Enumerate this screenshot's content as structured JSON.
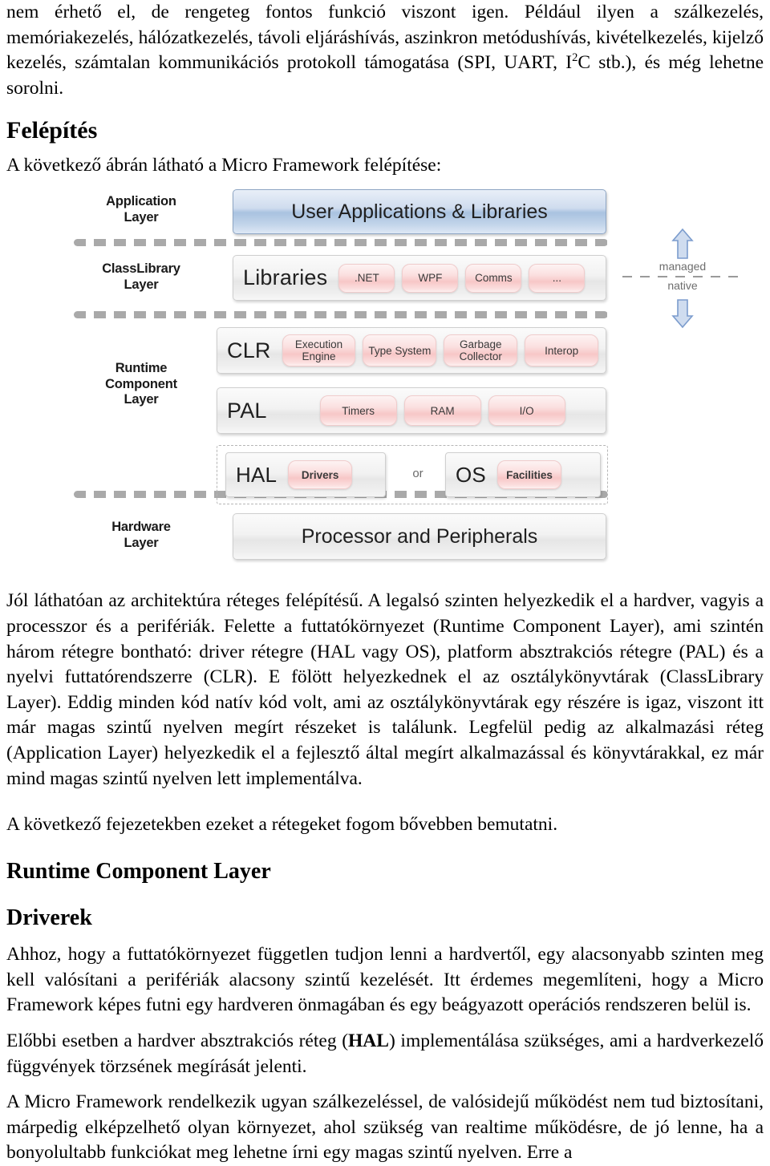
{
  "document": {
    "paragraph_top_part1": "nem érhető el, de rengeteg fontos funkció viszont igen. ",
    "paragraph_top_bold": "Például ilyen a szálkezelés, memóriakezelés, hálózatkezelés, távoli eljáráshívás, aszinkron metódushívás, kivételkezelés, kijelző kezelés, számtalan kommunikációs protokoll támogatása (SPI, UART, I",
    "paragraph_top_sup": "2",
    "paragraph_top_part3": "C stb.), és még lehetne sorolni.",
    "heading_felepites": "Felépítés",
    "intro_line": "A következő ábrán látható a Micro Framework felépítése:",
    "paragraph_after_figure": "Jól láthatóan az architektúra réteges felépítésű. A legalsó szinten helyezkedik el a hardver, vagyis a processzor és a perifériák. Felette a futtatókörnyezet (Runtime Component Layer), ami szintén három rétegre bontható: driver rétegre (HAL vagy OS), platform absztrakciós rétegre (PAL) és a nyelvi futtatórendszerre (CLR). E fölött helyezkednek el az osztálykönyvtárak (ClassLibrary Layer). Eddig minden kód natív kód volt, ami az osztálykönyvtárak egy részére is igaz, viszont itt már magas szintű nyelven megírt részeket is találunk. Legfelül pedig az alkalmazási réteg (Application Layer) helyezkedik el a fejlesztő által megírt alkalmazással és könyvtárakkal, ez már mind magas szintű nyelven lett implementálva.",
    "paragraph_next_chapters": "A következő fejezetekben ezeket a rétegeket fogom bővebben bemutatni.",
    "heading_runtime_component_layer": "Runtime Component Layer",
    "heading_driverek": "Driverek",
    "paragraph_drivers_1": "Ahhoz, hogy a futtatókörnyezet független tudjon lenni a hardvertől, egy alacsonyabb szinten meg kell valósítani a perifériák alacsony szintű kezelését. Itt érdemes megemlíteni, hogy a Micro Framework képes futni egy hardveren önmagában és egy beágyazott operációs rendszeren belül is.",
    "paragraph_drivers_2_a": "Előbbi esetben a hardver absztrakciós réteg (",
    "paragraph_drivers_2_bold": "HAL",
    "paragraph_drivers_2_b": ") implementálása szükséges, ami a hardverkezelő függvények törzsének megírását jelenti.",
    "paragraph_drivers_3": "A Micro Framework rendelkezik ugyan szálkezeléssel, de valósidejű működést nem tud biztosítani, márpedig elképzelhető olyan környezet, ahol szükség van realtime működésre, de jó lenne, ha a bonyolultabb funkciókat meg lehetne írni egy magas szintű nyelven. Erre a"
  },
  "figure": {
    "alt_title": "Micro Framework architecture layers",
    "layers": [
      {
        "label_line1": "Application",
        "label_line2": "Layer"
      },
      {
        "label_line1": "ClassLibrary",
        "label_line2": "Layer"
      },
      {
        "label_line1": "Runtime",
        "label_line2": "Component",
        "label_line3": "Layer"
      },
      {
        "label_line1": "Hardware",
        "label_line2": "Layer"
      }
    ],
    "application_bar": "User Applications & Libraries",
    "libraries_title": "Libraries",
    "libraries_items": [
      ".NET",
      "WPF",
      "Comms",
      "..."
    ],
    "clr_title": "CLR",
    "clr_items": [
      "Execution Engine",
      "Type System",
      "Garbage Collector",
      "Interop"
    ],
    "pal_title": "PAL",
    "pal_items": [
      "Timers",
      "RAM",
      "I/O"
    ],
    "hal_title": "HAL",
    "hal_item": "Drivers",
    "or_label": "or",
    "os_title": "OS",
    "os_item": "Facilities",
    "hardware_bar": "Processor and Peripherals",
    "annotation_managed": "managed",
    "annotation_native": "native",
    "colors": {
      "application_bar_blue": "#a9c2e0",
      "pill_pink": "#f7c7c7",
      "bar_grey": "#e6e6e6",
      "dash_grey": "#9a9a9a",
      "arrow_blue": "#7b9ccd"
    }
  }
}
